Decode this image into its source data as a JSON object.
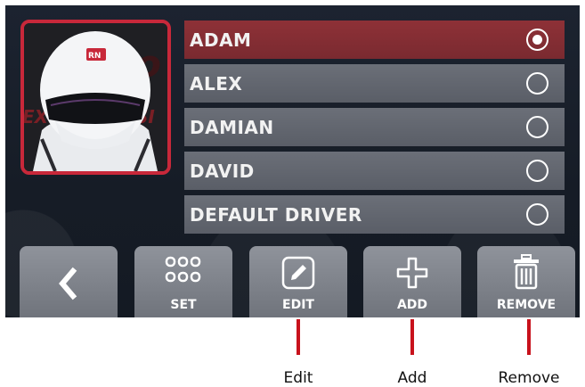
{
  "drivers": [
    {
      "name": "ADAM",
      "selected": true
    },
    {
      "name": "ALEX",
      "selected": false
    },
    {
      "name": "DAMIAN",
      "selected": false
    },
    {
      "name": "DAVID",
      "selected": false
    },
    {
      "name": "DEFAULT DRIVER",
      "selected": false
    }
  ],
  "avatar": {
    "description_icon": "driver-helmet-photo"
  },
  "toolbar": {
    "back_icon": "chevron-left-icon",
    "set_label": "SET",
    "edit_label": "EDIT",
    "add_label": "ADD",
    "remove_label": "REMOVE"
  },
  "annotations": {
    "edit": "Edit",
    "add": "Add",
    "remove": "Remove"
  },
  "colors": {
    "accent_red": "#c8283a",
    "selected_row": "#8e3137",
    "row": "#636770",
    "annotation_line": "#c8121c"
  }
}
